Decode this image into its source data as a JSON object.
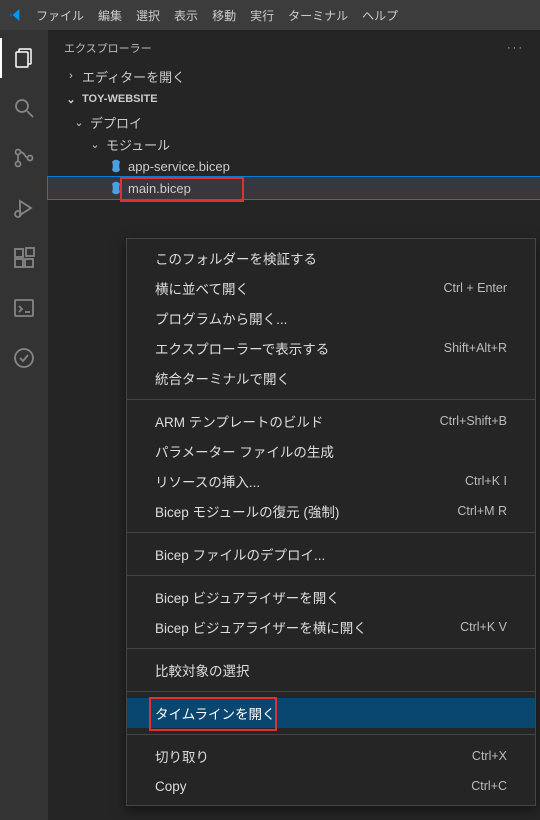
{
  "menubar": {
    "items": [
      "ファイル",
      "編集",
      "選択",
      "表示",
      "移動",
      "実行",
      "ターミナル",
      "ヘルプ"
    ]
  },
  "sidebar": {
    "title": "エクスプローラー",
    "open_editors": "エディターを開く",
    "project": "TOY-WEBSITE",
    "folders": {
      "deploy": "デプロイ",
      "modules": "モジュール"
    },
    "files": {
      "app_service": "app-service.bicep",
      "main": "main.bicep"
    }
  },
  "context_menu": {
    "items": [
      {
        "label": "このフォルダーを検証する",
        "shortcut": ""
      },
      {
        "label": "横に並べて開く",
        "shortcut": "Ctrl + Enter"
      },
      {
        "label": "プログラムから開く...",
        "shortcut": ""
      },
      {
        "label": "エクスプローラーで表示する",
        "shortcut": "Shift+Alt+R"
      },
      {
        "label": "統合ターミナルで開く",
        "shortcut": ""
      },
      {
        "sep": true
      },
      {
        "label": "ARM テンプレートのビルド",
        "shortcut": "Ctrl+Shift+B"
      },
      {
        "label": "パラメーター ファイルの生成",
        "shortcut": ""
      },
      {
        "label": "リソースの挿入...",
        "shortcut": "Ctrl+K I"
      },
      {
        "label": "Bicep モジュールの復元 (強制)",
        "shortcut": "Ctrl+M R"
      },
      {
        "sep": true
      },
      {
        "label": "Bicep ファイルのデプロイ...",
        "shortcut": ""
      },
      {
        "sep": true
      },
      {
        "label": "Bicep ビジュアライザーを開く",
        "shortcut": ""
      },
      {
        "label": "Bicep ビジュアライザーを横に開く",
        "shortcut": "Ctrl+K V"
      },
      {
        "sep": true
      },
      {
        "label": "比較対象の選択",
        "shortcut": ""
      },
      {
        "sep": true
      },
      {
        "label": "タイムラインを開く",
        "shortcut": "",
        "hover": true,
        "red": true
      },
      {
        "sep": true
      },
      {
        "label": "切り取り",
        "shortcut": "Ctrl+X"
      },
      {
        "label": "Copy",
        "shortcut": "Ctrl+C"
      }
    ]
  }
}
